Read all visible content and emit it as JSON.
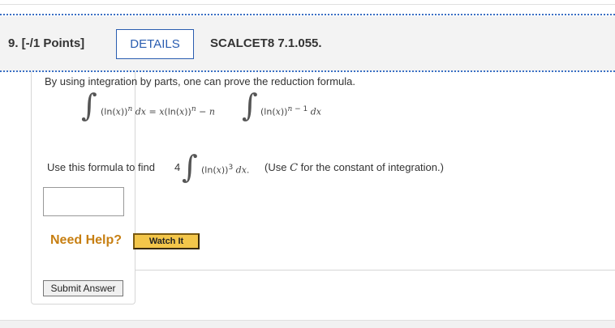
{
  "question": {
    "number_label": "9.  [-/1 Points]",
    "details_label": "DETAILS",
    "source_label": "SCALCET8 7.1.055."
  },
  "body": {
    "prompt": "By using integration by parts, one can prove the reduction formula.",
    "formula": {
      "integral_symbol": "∫",
      "lhs_html": "(ln(<i>x</i>))<sup><i>n</i></sup> <i>dx</i> = <i>x</i>(ln(<i>x</i>))<sup><i>n</i></sup> − <i>n</i>",
      "rhs_html": "(ln(<i>x</i>))<sup><i>n</i> − 1</sup> <i>dx</i>"
    },
    "use_text": "Use this formula to find",
    "coefficient": "4",
    "integrand_html": "(ln(<i>x</i>))<sup>3</sup> <i>dx</i>.",
    "note_html": "(Use <i>C</i> for the constant of integration.)"
  },
  "answer": {
    "value": "",
    "placeholder": ""
  },
  "help": {
    "need_help_label": "Need Help?",
    "watch_label": "Watch It"
  },
  "submit_label": "Submit Answer",
  "colors": {
    "accent_blue": "#2a5db0",
    "need_help_orange": "#c77f12",
    "watch_yellow": "#f3c64a"
  }
}
